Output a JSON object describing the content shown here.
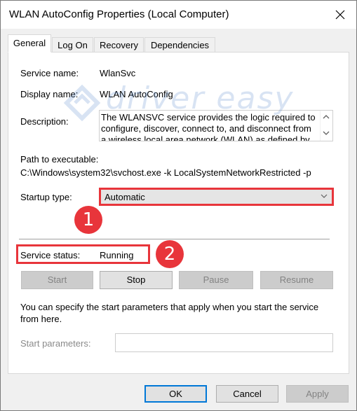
{
  "window": {
    "title": "WLAN AutoConfig Properties (Local Computer)"
  },
  "tabs": [
    {
      "label": "General",
      "active": true
    },
    {
      "label": "Log On",
      "active": false
    },
    {
      "label": "Recovery",
      "active": false
    },
    {
      "label": "Dependencies",
      "active": false
    }
  ],
  "general": {
    "service_name_label": "Service name:",
    "service_name_value": "WlanSvc",
    "display_name_label": "Display name:",
    "display_name_value": "WLAN AutoConfig",
    "description_label": "Description:",
    "description_value": "The WLANSVC service provides the logic required to configure, discover, connect to, and disconnect from a wireless local area network (WLAN) as defined by",
    "path_label": "Path to executable:",
    "path_value": "C:\\Windows\\system32\\svchost.exe -k LocalSystemNetworkRestricted -p",
    "startup_type_label": "Startup type:",
    "startup_type_value": "Automatic",
    "service_status_label": "Service status:",
    "service_status_value": "Running",
    "buttons": {
      "start": "Start",
      "stop": "Stop",
      "pause": "Pause",
      "resume": "Resume"
    },
    "start_params_note": "You can specify the start parameters that apply when you start the service from here.",
    "start_params_label": "Start parameters:",
    "start_params_value": ""
  },
  "annotations": {
    "badge_1": "1",
    "badge_2": "2",
    "watermark": "driver easy"
  },
  "footer": {
    "ok": "OK",
    "cancel": "Cancel",
    "apply": "Apply"
  },
  "colors": {
    "highlight": "#e8353b",
    "focus": "#0078d7",
    "watermark": "#2b6bbf"
  }
}
